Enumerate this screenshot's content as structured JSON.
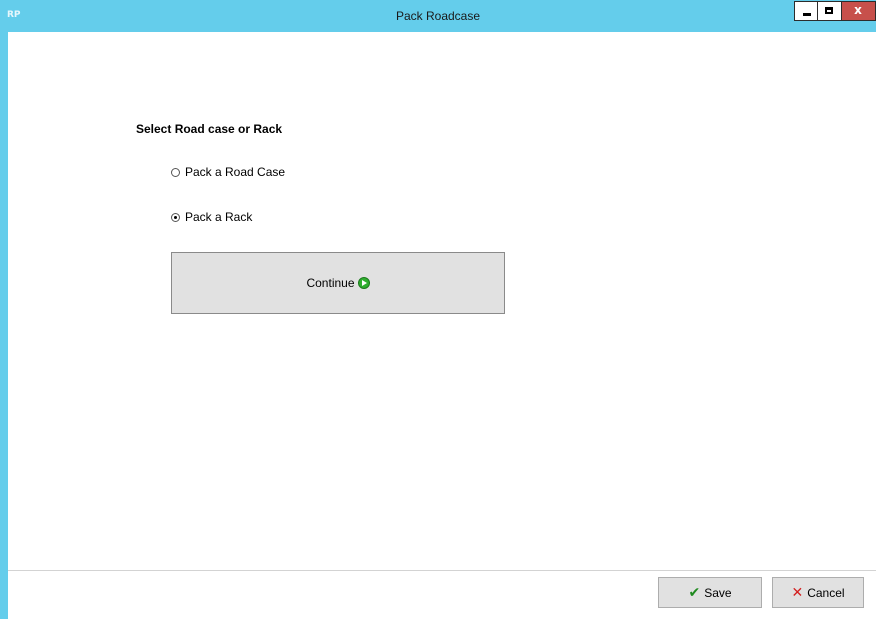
{
  "window": {
    "title": "Pack Roadcase",
    "app_icon_text": "RP",
    "controls": {
      "minimize": "minimize-icon",
      "maximize": "maximize-icon",
      "close": "x"
    }
  },
  "form": {
    "heading": "Select Road case or Rack",
    "options": [
      {
        "label": "Pack a Road Case",
        "selected": false
      },
      {
        "label": "Pack a Rack",
        "selected": true
      }
    ],
    "continue_label": "Continue"
  },
  "footer": {
    "save_label": "Save",
    "cancel_label": "Cancel"
  },
  "colors": {
    "titlebar": "#64cdeb",
    "close_button": "#c7504b",
    "button_face": "#e1e1e1"
  }
}
